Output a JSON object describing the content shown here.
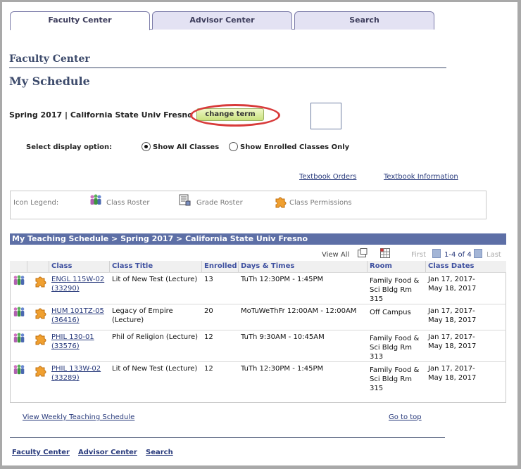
{
  "tabs": [
    "Faculty Center",
    "Advisor Center",
    "Search"
  ],
  "heading": "Faculty Center",
  "page_title": "My Schedule",
  "term_line": "Spring 2017 | California State Univ  Fresno",
  "change_term_label": "change term",
  "display_option": {
    "label": "Select display option:",
    "options": [
      "Show All Classes",
      "Show Enrolled Classes Only"
    ],
    "selected": "Show All Classes"
  },
  "links": {
    "textbook_orders": "Textbook Orders",
    "textbook_information": "Textbook Information"
  },
  "legend": {
    "label": "Icon Legend:",
    "items": [
      "Class Roster",
      "Grade Roster",
      "Class Permissions"
    ]
  },
  "grid": {
    "title": "My Teaching Schedule > Spring 2017 > California State Univ Fresno",
    "view_all": "View All",
    "first": "First",
    "range": "1-4 of 4",
    "last": "Last",
    "columns": [
      "Class",
      "Class Title",
      "Enrolled",
      "Days & Times",
      "Room",
      "Class Dates"
    ],
    "rows": [
      {
        "class_code": "ENGL 115W-02",
        "class_number": "(33290)",
        "title_1": "Lit of New Test (Lecture)",
        "title_2": "",
        "enrolled": "13",
        "days_times": "TuTh 12:30PM - 1:45PM",
        "room_1": "Family Food &",
        "room_2": "Sci Bldg Rm",
        "room_3": "315",
        "date_start": "Jan 17, 2017-",
        "date_end": "May 18, 2017"
      },
      {
        "class_code": "HUM 101TZ-05",
        "class_number": "(36416)",
        "title_1": "Legacy of Empire",
        "title_2": "(Lecture)",
        "enrolled": "20",
        "days_times": "MoTuWeThFr 12:00AM - 12:00AM",
        "room_1": "Off Campus",
        "room_2": "",
        "room_3": "",
        "date_start": "Jan 17, 2017-",
        "date_end": "May 18, 2017"
      },
      {
        "class_code": "PHIL 130-01",
        "class_number": "(33576)",
        "title_1": "Phil of Religion (Lecture)",
        "title_2": "",
        "enrolled": "12",
        "days_times": "TuTh 9:30AM - 10:45AM",
        "room_1": "Family Food &",
        "room_2": "Sci Bldg Rm",
        "room_3": "313",
        "date_start": "Jan 17, 2017-",
        "date_end": "May 18, 2017"
      },
      {
        "class_code": "PHIL 133W-02",
        "class_number": "(33289)",
        "title_1": "Lit of New Test (Lecture)",
        "title_2": "",
        "enrolled": "12",
        "days_times": "TuTh 12:30PM - 1:45PM",
        "room_1": "Family Food &",
        "room_2": "Sci Bldg Rm",
        "room_3": "315",
        "date_start": "Jan 17, 2017-",
        "date_end": "May 18, 2017"
      }
    ]
  },
  "view_weekly": "View Weekly Teaching Schedule",
  "go_to_top": "Go to top",
  "footer_links": [
    "Faculty Center",
    "Advisor Center",
    "Search"
  ],
  "colors": {
    "grid_header": "#5d6fa6",
    "link": "#27397b",
    "heading": "#3c4a6b",
    "highlight_ring": "#d83a3a",
    "button": "#c9e27e"
  }
}
